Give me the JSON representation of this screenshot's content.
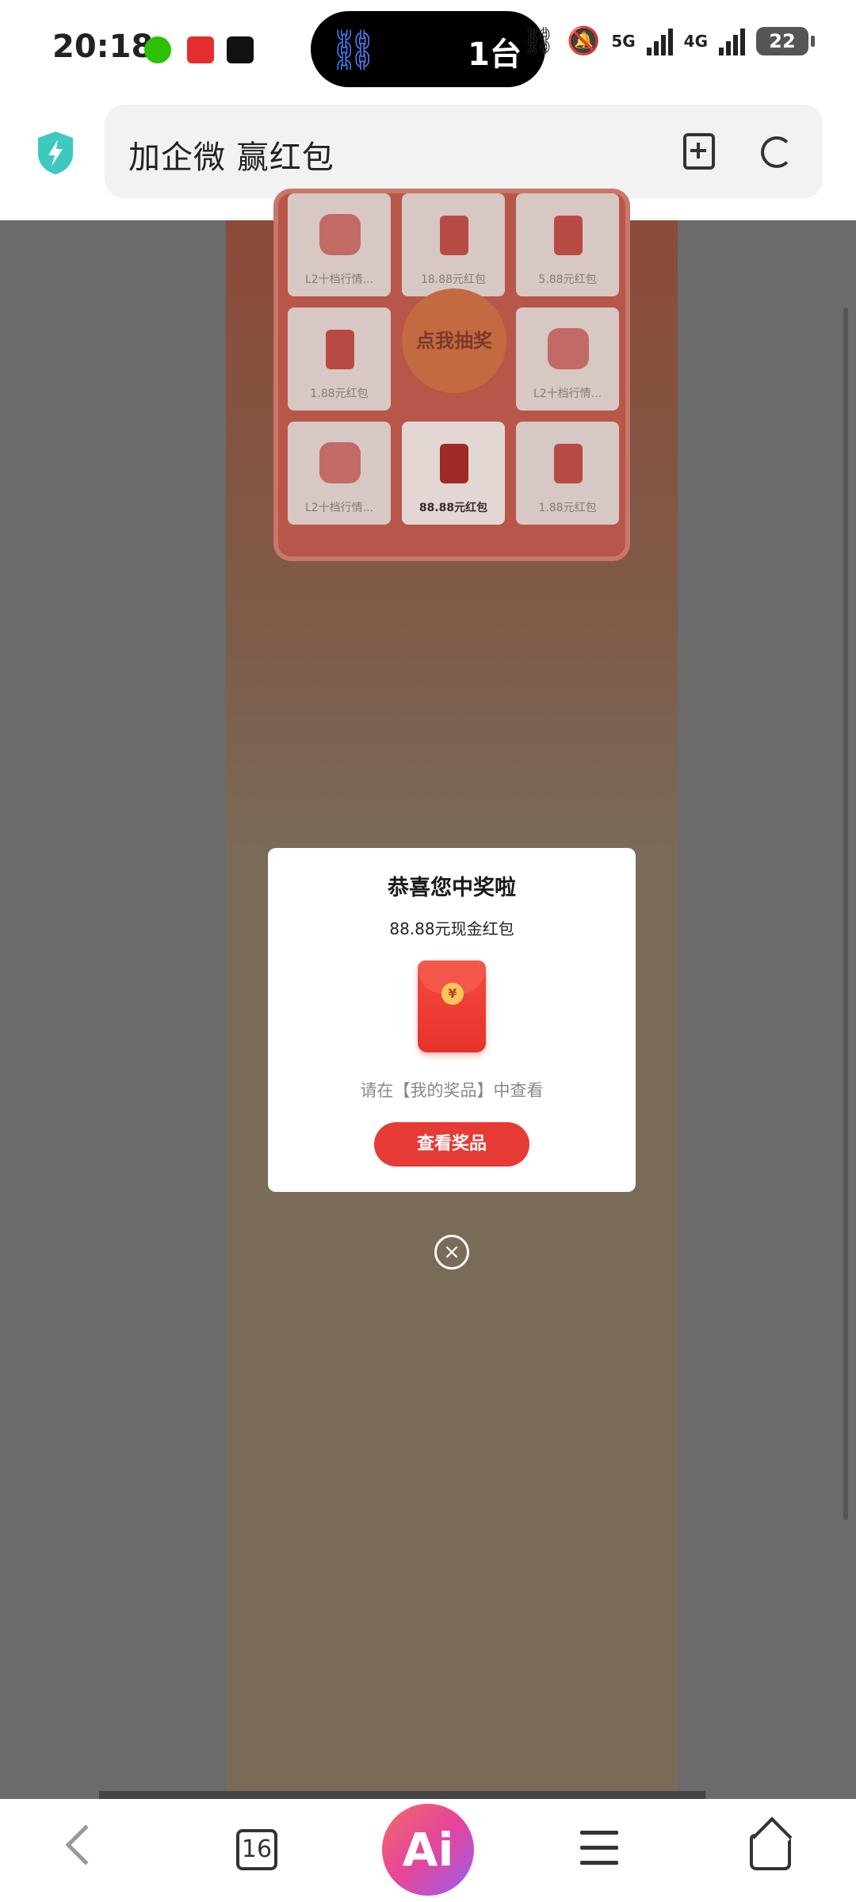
{
  "status_bar": {
    "time": "20:18",
    "island_text": "1台",
    "net1": "5G",
    "net2": "4G",
    "battery": "22"
  },
  "url_bar": {
    "title": "加企微 赢红包"
  },
  "lottery": {
    "draw_button": "点我抽奖",
    "prizes": [
      {
        "label": "L2十档行情..."
      },
      {
        "label": "18.88元红包"
      },
      {
        "label": "5.88元红包"
      },
      {
        "label": "1.88元红包"
      },
      {
        "label": "L2十档行情..."
      },
      {
        "label": "L2十档行情..."
      },
      {
        "label": "88.88元红包"
      },
      {
        "label": "1.88元红包"
      }
    ]
  },
  "modal": {
    "title": "恭喜您中奖啦",
    "prize": "88.88元现金红包",
    "coin_symbol": "¥",
    "hint": "请在【我的奖品】中查看",
    "button": "查看奖品",
    "close_symbol": "×"
  },
  "bottom_nav": {
    "tabs_count": "16",
    "ai_label": "Ai"
  },
  "colors": {
    "accent_red": "#e63a35",
    "shield": "#3dc8c0"
  }
}
